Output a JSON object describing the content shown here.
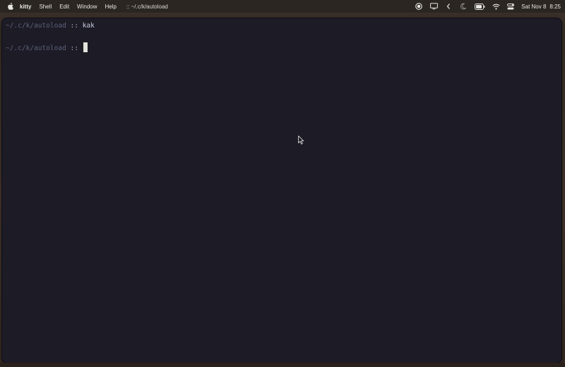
{
  "menubar": {
    "app_name": "kitty",
    "menus": [
      "Shell",
      "Edit",
      "Window",
      "Help"
    ],
    "window_title": ":: ~/.c/k/autoload",
    "status": {
      "date": "Sat Nov 8",
      "time": "8:25",
      "icons": [
        "record-icon",
        "display-icon",
        "chevron-left-icon",
        "moon-icon",
        "battery-icon",
        "wifi-icon",
        "control-center-icon"
      ]
    }
  },
  "terminal": {
    "lines": [
      {
        "path": "~/.c/k/autoload",
        "separator": " :: ",
        "command": "kak"
      },
      {
        "path": "~/.c/k/autoload",
        "separator": " :: ",
        "command": ""
      }
    ],
    "colors": {
      "background": "#1c1b26",
      "path": "#5d607a",
      "cursor": "#e4e2dc"
    }
  }
}
